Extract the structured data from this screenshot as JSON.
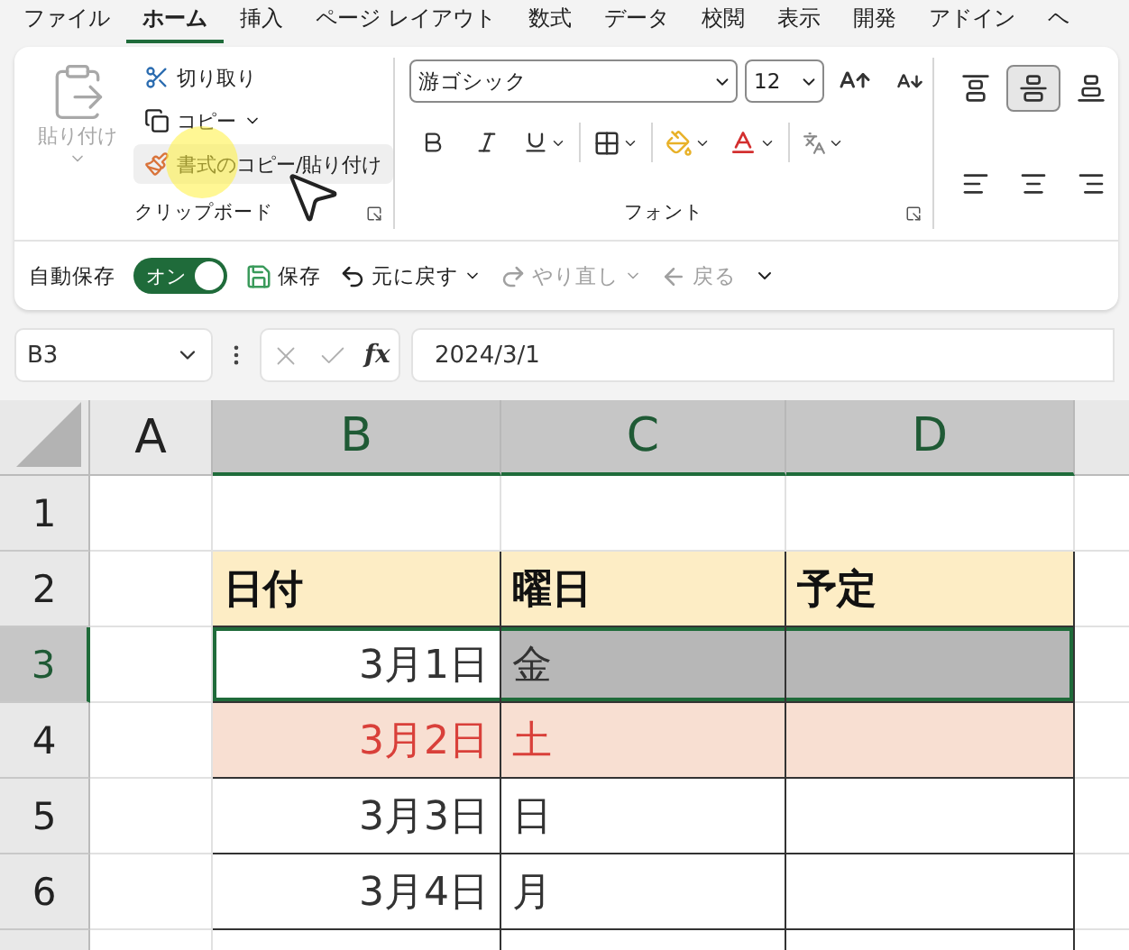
{
  "tabs": [
    {
      "label": "ファイル",
      "selected": false
    },
    {
      "label": "ホーム",
      "selected": true
    },
    {
      "label": "挿入",
      "selected": false
    },
    {
      "label": "ページ レイアウト",
      "selected": false
    },
    {
      "label": "数式",
      "selected": false
    },
    {
      "label": "データ",
      "selected": false
    },
    {
      "label": "校閲",
      "selected": false
    },
    {
      "label": "表示",
      "selected": false
    },
    {
      "label": "開発",
      "selected": false
    },
    {
      "label": "アドイン",
      "selected": false
    },
    {
      "label": "ヘ",
      "selected": false
    }
  ],
  "clipboard": {
    "paste": {
      "label": "貼り付け",
      "disabled": true
    },
    "cut": "切り取り",
    "copy": "コピー",
    "format_painter": "書式のコピー/貼り付け",
    "label": "クリップボード"
  },
  "font": {
    "name": "游ゴシック",
    "size": "12",
    "label": "フォント"
  },
  "alignment": [
    {
      "kind": "top",
      "selected": false
    },
    {
      "kind": "middle",
      "selected": true
    },
    {
      "kind": "bottom",
      "selected": false
    },
    {
      "kind": "left",
      "selected": false
    },
    {
      "kind": "center",
      "selected": false
    },
    {
      "kind": "right",
      "selected": false
    }
  ],
  "quick_access": {
    "autosave_label": "自動保存",
    "autosave": {
      "text": "オン",
      "on": true
    },
    "save": "保存",
    "undo": {
      "label": "元に戻す",
      "disabled": false
    },
    "redo": {
      "label": "やり直し",
      "disabled": true
    },
    "back": {
      "label": "戻る",
      "disabled": true
    }
  },
  "formula_bar": {
    "name_box": "B3",
    "function_label": "fx",
    "value": "2024/3/1"
  },
  "sheet": {
    "columns": [
      {
        "label": "A",
        "selected": false
      },
      {
        "label": "B",
        "selected": true
      },
      {
        "label": "C",
        "selected": true
      },
      {
        "label": "D",
        "selected": true
      }
    ],
    "rows": [
      {
        "number": "1",
        "selected": false,
        "kind": "blank",
        "cells": [
          {
            "selected": false,
            "active": false
          },
          {
            "selected": false,
            "active": false
          },
          {
            "selected": false,
            "active": false
          },
          {
            "selected": false,
            "active": false
          }
        ]
      },
      {
        "number": "2",
        "selected": false,
        "kind": "header",
        "cells": [
          {
            "selected": false,
            "active": false
          },
          {
            "text": "日付",
            "selected": false,
            "active": false
          },
          {
            "text": "曜日",
            "selected": false,
            "active": false
          },
          {
            "text": "予定",
            "selected": false,
            "active": false
          }
        ]
      },
      {
        "number": "3",
        "selected": true,
        "kind": "weekday",
        "cells": [
          {
            "selected": false,
            "active": false
          },
          {
            "text": "3月1日",
            "selected": true,
            "active": true
          },
          {
            "text": "金",
            "selected": true,
            "active": false
          },
          {
            "selected": true,
            "active": false
          }
        ]
      },
      {
        "number": "4",
        "selected": false,
        "kind": "weekend",
        "cells": [
          {
            "selected": false,
            "active": false
          },
          {
            "text": "3月2日",
            "selected": false,
            "active": false
          },
          {
            "text": "土",
            "selected": false,
            "active": false
          },
          {
            "selected": false,
            "active": false
          }
        ]
      },
      {
        "number": "5",
        "selected": false,
        "kind": "weekday",
        "cells": [
          {
            "selected": false,
            "active": false
          },
          {
            "text": "3月3日",
            "selected": false,
            "active": false
          },
          {
            "text": "日",
            "selected": false,
            "active": false
          },
          {
            "selected": false,
            "active": false
          }
        ]
      },
      {
        "number": "6",
        "selected": false,
        "kind": "weekday",
        "cells": [
          {
            "selected": false,
            "active": false
          },
          {
            "text": "3月4日",
            "selected": false,
            "active": false
          },
          {
            "text": "月",
            "selected": false,
            "active": false
          },
          {
            "selected": false,
            "active": false
          }
        ]
      }
    ]
  }
}
